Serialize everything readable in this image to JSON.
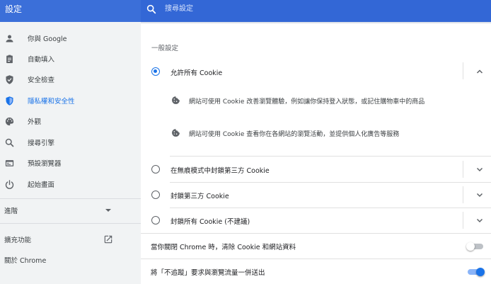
{
  "header": {
    "title": "設定",
    "search_placeholder": "搜尋設定"
  },
  "sidebar": {
    "items": [
      {
        "label": "你與 Google",
        "icon": "person-icon"
      },
      {
        "label": "自動填入",
        "icon": "clipboard-icon"
      },
      {
        "label": "安全檢查",
        "icon": "shield-check-icon"
      },
      {
        "label": "隱私權和安全性",
        "icon": "shield-icon",
        "active": true
      },
      {
        "label": "外觀",
        "icon": "palette-icon"
      },
      {
        "label": "搜尋引擎",
        "icon": "search-icon"
      },
      {
        "label": "預設瀏覽器",
        "icon": "browser-icon"
      },
      {
        "label": "起始畫面",
        "icon": "power-icon"
      }
    ],
    "advanced_label": "進階",
    "extensions_label": "擴充功能",
    "about_label": "關於 Chrome"
  },
  "content": {
    "section_title": "一般設定",
    "options": [
      {
        "label": "允許所有 Cookie",
        "checked": true,
        "expanded": true
      },
      {
        "label": "在無痕模式中封鎖第三方 Cookie",
        "checked": false
      },
      {
        "label": "封鎖第三方 Cookie",
        "checked": false
      },
      {
        "label": "封鎖所有 Cookie (不建議)",
        "checked": false
      }
    ],
    "sub_items": [
      "網站可使用 Cookie 改善瀏覽體驗，例如讓你保持登入狀態，或記住購物車中的商品",
      "網站可使用 Cookie 查看你在各網站的瀏覽活動，並提供個人化廣告等服務"
    ],
    "toggles": [
      {
        "label": "當你關閉 Chrome 時，清除 Cookie 和網站資料",
        "on": false
      },
      {
        "label": "將「不追蹤」要求與瀏覽流量一併送出",
        "on": true
      }
    ]
  },
  "colors": {
    "header_blue": "#3367d6",
    "accent": "#1a73e8"
  }
}
